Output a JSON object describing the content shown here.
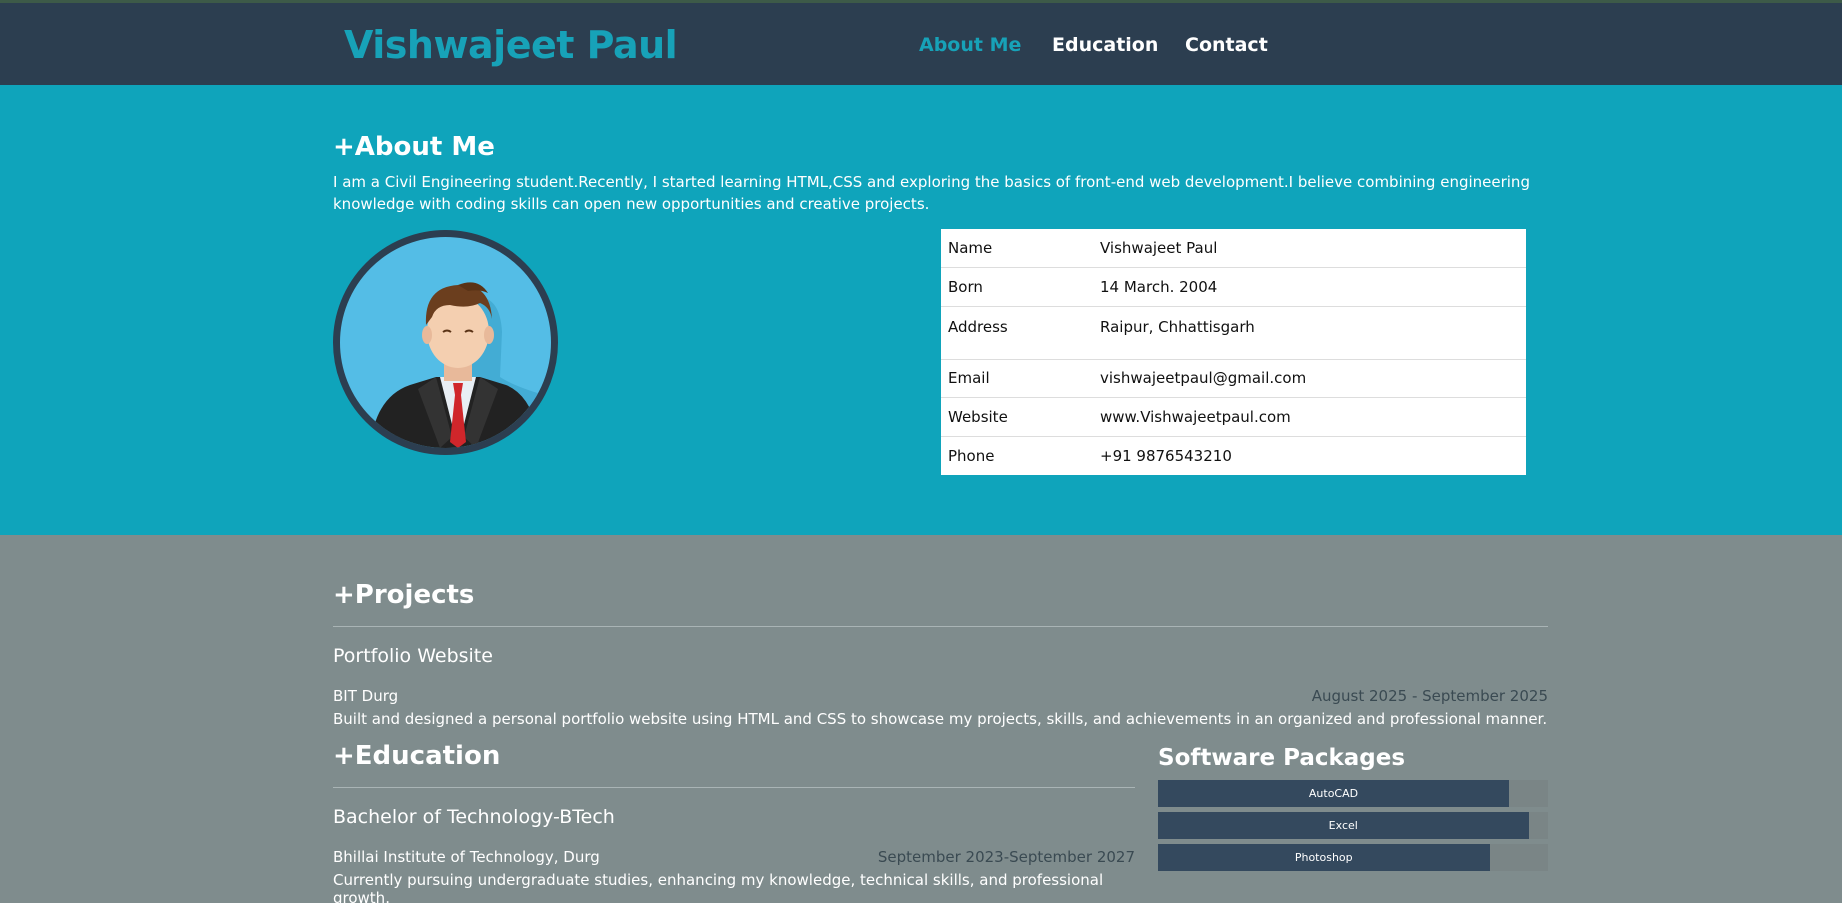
{
  "header": {
    "logo": "Vishwajeet Paul",
    "nav": [
      {
        "label": "About Me",
        "active": true
      },
      {
        "label": "Education",
        "active": false
      },
      {
        "label": "Contact",
        "active": false
      }
    ]
  },
  "about": {
    "heading": "+About Me",
    "text": "I am a Civil Engineering student.Recently, I started learning HTML,CSS and exploring the basics of front-end web development.I believe combining engineering knowledge with coding skills can open new opportunities and creative projects.",
    "avatar_icon": "person-avatar-icon",
    "info": [
      {
        "key": "Name",
        "value": "Vishwajeet Paul"
      },
      {
        "key": "Born",
        "value": "14 March. 2004"
      },
      {
        "key": "Address",
        "value": "Raipur, Chhattisgarh"
      },
      {
        "key": "Email",
        "value": "vishwajeetpaul@gmail.com"
      },
      {
        "key": "Website",
        "value": "www.Vishwajeetpaul.com"
      },
      {
        "key": "Phone",
        "value": "+91 9876543210"
      }
    ]
  },
  "projects": {
    "heading": "+Projects",
    "items": [
      {
        "title": "Portfolio Website",
        "org": "BIT Durg",
        "dates": "August 2025 - September 2025",
        "description": "Built and designed a personal portfolio website using HTML and CSS to showcase my projects, skills, and achievements in an organized and professional manner."
      }
    ]
  },
  "education": {
    "heading": "+Education",
    "items": [
      {
        "title": "Bachelor of Technology-BTech",
        "org": "Bhillai Institute of Technology, Durg",
        "dates": "September 2023-September 2027",
        "description": "Currently pursuing undergraduate studies, enhancing my knowledge, technical skills, and professional growth."
      }
    ]
  },
  "software": {
    "heading": "Software Packages",
    "skills": [
      {
        "name": "AutoCAD",
        "level": 0.9
      },
      {
        "name": "Excel",
        "level": 0.95
      },
      {
        "name": "Photoshop",
        "level": 0.85
      }
    ]
  },
  "colors": {
    "accent": "#17a2b8",
    "header_bg": "#2c3e50",
    "about_bg": "#0fa4bb",
    "body_bg": "#7f8c8d",
    "bar_fill": "#34495e"
  }
}
